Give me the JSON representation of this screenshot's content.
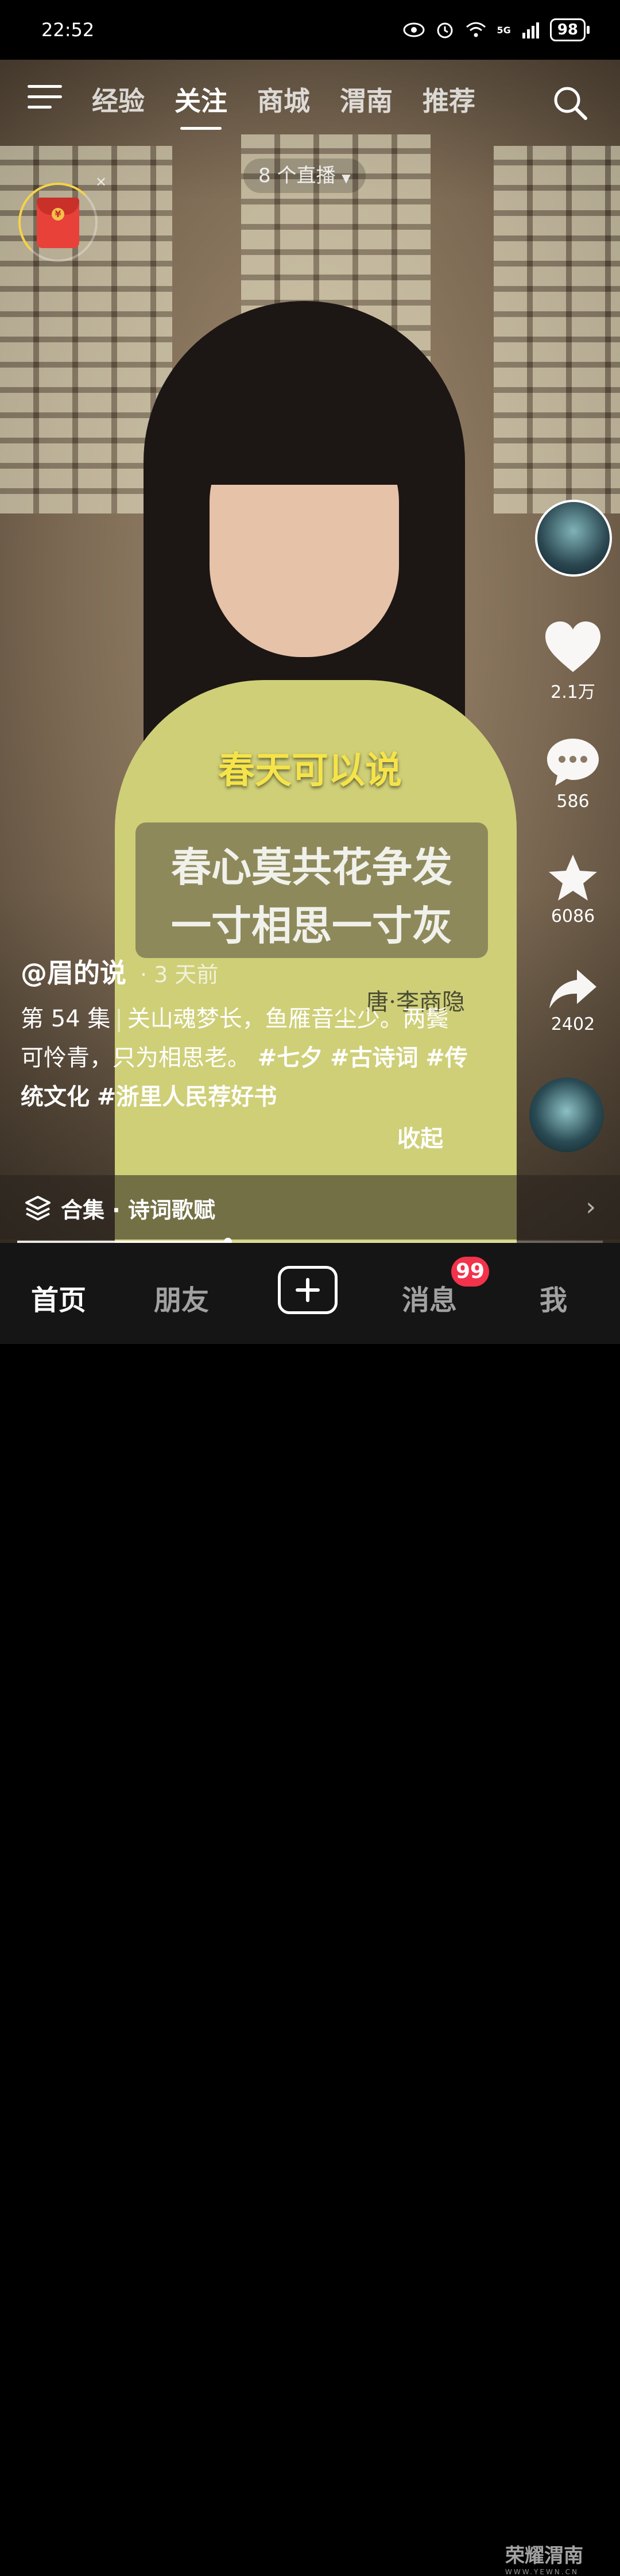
{
  "status": {
    "time": "22:52",
    "network": "5G",
    "battery": "98"
  },
  "nav": {
    "tabs": [
      {
        "label": "经验"
      },
      {
        "label": "关注"
      },
      {
        "label": "商城"
      },
      {
        "label": "渭南"
      },
      {
        "label": "推荐"
      }
    ],
    "active_tab": "关注"
  },
  "live": {
    "label": "8 个直播"
  },
  "sidebar": {
    "likes": "2.1万",
    "comments": "586",
    "favorites": "6086",
    "shares": "2402"
  },
  "video": {
    "caption_yellow": "春天可以说",
    "poem_line1": "春心莫共花争发",
    "poem_line2": "一寸相思一寸灰",
    "poem_author": "唐·李商隐"
  },
  "post": {
    "author": "@眉的说",
    "time": "· 3 天前",
    "episode": "第 54 集",
    "desc_text": "关山魂梦长，鱼雁音尘少。两鬓可怜青，只为相思老。",
    "tags": [
      "#七夕",
      "#古诗词",
      "#传统文化",
      "#浙里人民荐好书"
    ],
    "collapse_label": "收起"
  },
  "collection": {
    "label": "合集 · 诗词歌赋"
  },
  "progress": {
    "fraction": 0.36
  },
  "bottom_nav": {
    "home": "首页",
    "friends": "朋友",
    "messages": "消息",
    "me": "我",
    "badge": "99"
  },
  "watermark": {
    "main": "荣耀渭南",
    "sub": "WWW.YEWN.CN"
  },
  "colors": {
    "caption_yellow": "#f5e34a",
    "badge_red": "#f3324b",
    "redpacket": "#e8413a"
  }
}
